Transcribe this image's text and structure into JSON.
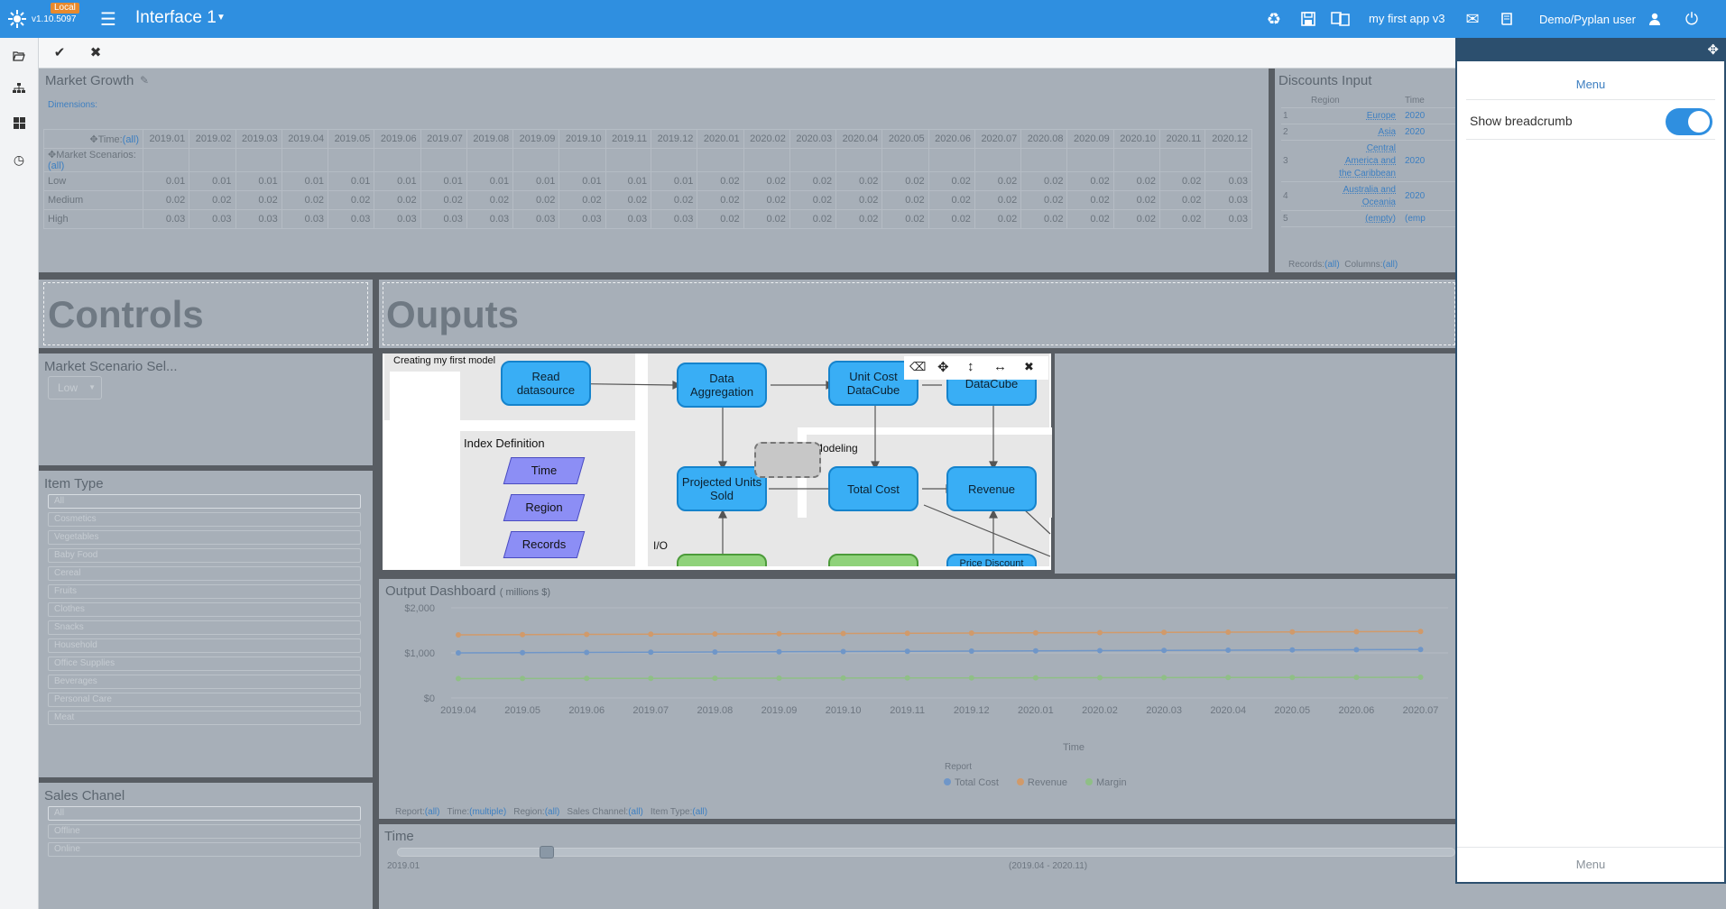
{
  "topbar": {
    "version": "v1.10.5097",
    "local_badge": "Local",
    "interface_title": "Interface 1",
    "app_name": "my first app v3",
    "user": "Demo/Pyplan user"
  },
  "toolbar": {
    "accept_icon": "check-icon",
    "cancel_icon": "close-icon"
  },
  "market_growth": {
    "title": "Market Growth",
    "dimensions_label": "Dimensions:",
    "time_label": "Time:",
    "time_filter": "(all)",
    "scenario_label": "Market Scenarios:",
    "scenario_filter": "(all)",
    "columns": [
      "2019.01",
      "2019.02",
      "2019.03",
      "2019.04",
      "2019.05",
      "2019.06",
      "2019.07",
      "2019.08",
      "2019.09",
      "2019.10",
      "2019.11",
      "2019.12",
      "2020.01",
      "2020.02",
      "2020.03",
      "2020.04",
      "2020.05",
      "2020.06",
      "2020.07",
      "2020.08",
      "2020.09",
      "2020.10",
      "2020.11",
      "2020.12"
    ],
    "rows": [
      {
        "label": "Low",
        "values": [
          "0.01",
          "0.01",
          "0.01",
          "0.01",
          "0.01",
          "0.01",
          "0.01",
          "0.01",
          "0.01",
          "0.01",
          "0.01",
          "0.01",
          "0.02",
          "0.02",
          "0.02",
          "0.02",
          "0.02",
          "0.02",
          "0.02",
          "0.02",
          "0.02",
          "0.02",
          "0.02",
          "0.03"
        ]
      },
      {
        "label": "Medium",
        "values": [
          "0.02",
          "0.02",
          "0.02",
          "0.02",
          "0.02",
          "0.02",
          "0.02",
          "0.02",
          "0.02",
          "0.02",
          "0.02",
          "0.02",
          "0.02",
          "0.02",
          "0.02",
          "0.02",
          "0.02",
          "0.02",
          "0.02",
          "0.02",
          "0.02",
          "0.02",
          "0.02",
          "0.03"
        ]
      },
      {
        "label": "High",
        "values": [
          "0.03",
          "0.03",
          "0.03",
          "0.03",
          "0.03",
          "0.03",
          "0.03",
          "0.03",
          "0.03",
          "0.03",
          "0.03",
          "0.03",
          "0.02",
          "0.02",
          "0.02",
          "0.02",
          "0.02",
          "0.02",
          "0.02",
          "0.02",
          "0.02",
          "0.02",
          "0.02",
          "0.03"
        ]
      }
    ]
  },
  "discounts": {
    "title": "Discounts Input",
    "headers": [
      "Region",
      "Time"
    ],
    "rows": [
      {
        "n": "1",
        "region": "Europe",
        "time": "2020"
      },
      {
        "n": "2",
        "region": "Asia",
        "time": "2020"
      },
      {
        "n": "3",
        "region": "Central America and the Caribbean",
        "time": "2020"
      },
      {
        "n": "4",
        "region": "Australia and Oceania",
        "time": "2020"
      },
      {
        "n": "5",
        "region": "(empty)",
        "time": "(emp"
      }
    ],
    "records_label": "Records:",
    "records_filter": "(all)",
    "columns_label": "Columns:",
    "columns_filter": "(all)"
  },
  "controls": {
    "title": "Controls",
    "market_scenario_title": "Market Scenario Sel...",
    "market_scenario_value": "Low",
    "item_type_title": "Item Type",
    "item_types": [
      "All",
      "Cosmetics",
      "Vegetables",
      "Baby Food",
      "Cereal",
      "Fruits",
      "Clothes",
      "Snacks",
      "Household",
      "Office Supplies",
      "Beverages",
      "Personal Care",
      "Meat"
    ],
    "sales_channel_title": "Sales Chanel",
    "sales_channels": [
      "All",
      "Offline",
      "Online"
    ]
  },
  "outputs": {
    "title": "Ouputs",
    "diagram": {
      "model_title": "Creating my first model",
      "index_title": "Index Definition",
      "modeling_label": "Modeling",
      "io_label": "I/O",
      "nodes": {
        "read": "Read datasource",
        "aggregation": "Data Aggregation",
        "unit_cost": "Unit Cost DataCube",
        "datacube": "DataCube",
        "projected": "Projected Units Sold",
        "total_cost": "Total Cost",
        "revenue": "Revenue",
        "price_partial": "Price Discount"
      },
      "indexes": [
        "Time",
        "Region",
        "Records"
      ]
    },
    "dashboard": {
      "title": "Output Dashboard",
      "subtitle": "( millions $)",
      "filters": [
        {
          "label": "Report:",
          "value": "(all)"
        },
        {
          "label": "Time:",
          "value": "(multiple)"
        },
        {
          "label": "Region:",
          "value": "(all)"
        },
        {
          "label": "Sales Channel:",
          "value": "(all)"
        },
        {
          "label": "Item Type:",
          "value": "(all)"
        }
      ]
    },
    "time_slider": {
      "title": "Time",
      "start_label": "2019.01",
      "range_label": "(2019.04 - 2020.11)",
      "position": 0.02
    }
  },
  "chart_data": {
    "type": "line",
    "title": "Output Dashboard",
    "xlabel": "Time",
    "ylabel": "",
    "x": [
      "2019.04",
      "2019.05",
      "2019.06",
      "2019.07",
      "2019.08",
      "2019.09",
      "2019.10",
      "2019.11",
      "2019.12",
      "2020.01",
      "2020.02",
      "2020.03",
      "2020.04",
      "2020.05",
      "2020.06",
      "2020.07"
    ],
    "ylim": [
      0,
      2000
    ],
    "yticks": [
      "$0",
      "$1,000",
      "$2,000"
    ],
    "legend_title": "Report",
    "legend_position": "bottom",
    "series": [
      {
        "name": "Total Cost",
        "color": "#6f96c8",
        "values": [
          1000,
          1005,
          1010,
          1015,
          1020,
          1025,
          1030,
          1035,
          1040,
          1045,
          1050,
          1055,
          1060,
          1065,
          1070,
          1075
        ]
      },
      {
        "name": "Revenue",
        "color": "#d19a6a",
        "values": [
          1400,
          1405,
          1410,
          1415,
          1420,
          1425,
          1430,
          1435,
          1440,
          1445,
          1450,
          1455,
          1460,
          1465,
          1470,
          1475
        ]
      },
      {
        "name": "Margin",
        "color": "#8fbf86",
        "values": [
          430,
          432,
          434,
          436,
          438,
          440,
          442,
          444,
          446,
          448,
          450,
          452,
          454,
          456,
          458,
          460
        ]
      }
    ]
  },
  "drawer": {
    "menu_title": "Menu",
    "breadcrumb_label": "Show breadcrumb",
    "breadcrumb_on": true,
    "footer_label": "Menu"
  }
}
